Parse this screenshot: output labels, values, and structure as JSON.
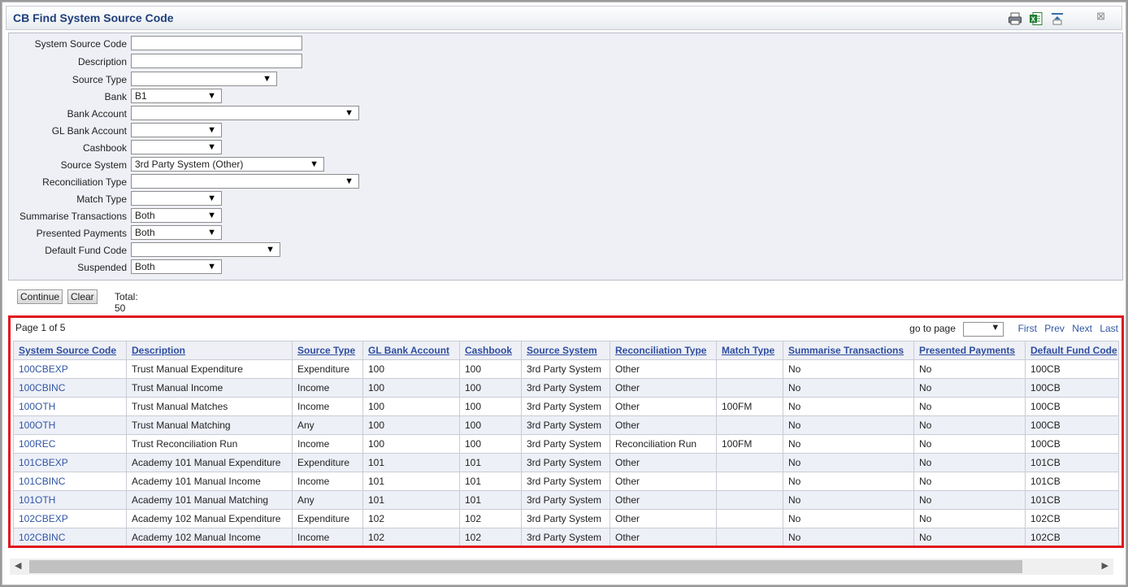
{
  "window": {
    "title": "CB Find System Source Code"
  },
  "toolbar": {
    "icons": [
      "printer-icon",
      "excel-export-icon",
      "collapse-panel-icon"
    ],
    "close": "⊠"
  },
  "filters": [
    {
      "label": "System Source Code",
      "value": "",
      "type": "text"
    },
    {
      "label": "Description",
      "value": "",
      "type": "text"
    },
    {
      "label": "Source Type",
      "value": "",
      "type": "select"
    },
    {
      "label": "Bank",
      "value": "B1",
      "type": "select"
    },
    {
      "label": "Bank Account",
      "value": "",
      "type": "select"
    },
    {
      "label": "GL Bank Account",
      "value": "",
      "type": "select"
    },
    {
      "label": "Cashbook",
      "value": "",
      "type": "select"
    },
    {
      "label": "Source System",
      "value": "3rd Party System (Other)",
      "type": "select"
    },
    {
      "label": "Reconciliation Type",
      "value": "",
      "type": "select"
    },
    {
      "label": "Match Type",
      "value": "",
      "type": "select"
    },
    {
      "label": "Summarise Transactions",
      "value": "Both",
      "type": "select"
    },
    {
      "label": "Presented Payments",
      "value": "Both",
      "type": "select"
    },
    {
      "label": "Default Fund Code",
      "value": "",
      "type": "select"
    },
    {
      "label": "Suspended",
      "value": "Both",
      "type": "select"
    }
  ],
  "actions": {
    "continue_label": "Continue",
    "clear_label": "Clear",
    "total_label": "Total: 50"
  },
  "pager": {
    "page_info": "Page 1 of 5",
    "goto_label": "go to page",
    "goto_value": "",
    "first": "First",
    "prev": "Prev",
    "next": "Next",
    "last": "Last"
  },
  "table": {
    "columns": [
      "System Source Code",
      "Description",
      "Source Type",
      "GL Bank Account",
      "Cashbook",
      "Source System",
      "Reconciliation Type",
      "Match Type",
      "Summarise Transactions",
      "Presented Payments",
      "Default Fund Code"
    ],
    "rows": [
      [
        "100CBEXP",
        "Trust Manual Expenditure",
        "Expenditure",
        "100",
        "100",
        "3rd Party System",
        "Other",
        "",
        "No",
        "No",
        "100CB"
      ],
      [
        "100CBINC",
        "Trust Manual Income",
        "Income",
        "100",
        "100",
        "3rd Party System",
        "Other",
        "",
        "No",
        "No",
        "100CB"
      ],
      [
        "100OTH",
        "Trust Manual Matches",
        "Income",
        "100",
        "100",
        "3rd Party System",
        "Other",
        "100FM",
        "No",
        "No",
        "100CB"
      ],
      [
        "100OTH",
        "Trust Manual Matching",
        "Any",
        "100",
        "100",
        "3rd Party System",
        "Other",
        "",
        "No",
        "No",
        "100CB"
      ],
      [
        "100REC",
        "Trust Reconciliation Run",
        "Income",
        "100",
        "100",
        "3rd Party System",
        "Reconciliation Run",
        "100FM",
        "No",
        "No",
        "100CB"
      ],
      [
        "101CBEXP",
        "Academy 101 Manual Expenditure",
        "Expenditure",
        "101",
        "101",
        "3rd Party System",
        "Other",
        "",
        "No",
        "No",
        "101CB"
      ],
      [
        "101CBINC",
        "Academy 101 Manual Income",
        "Income",
        "101",
        "101",
        "3rd Party System",
        "Other",
        "",
        "No",
        "No",
        "101CB"
      ],
      [
        "101OTH",
        "Academy 101 Manual Matching",
        "Any",
        "101",
        "101",
        "3rd Party System",
        "Other",
        "",
        "No",
        "No",
        "101CB"
      ],
      [
        "102CBEXP",
        "Academy 102 Manual Expenditure",
        "Expenditure",
        "102",
        "102",
        "3rd Party System",
        "Other",
        "",
        "No",
        "No",
        "102CB"
      ],
      [
        "102CBINC",
        "Academy 102 Manual Income",
        "Income",
        "102",
        "102",
        "3rd Party System",
        "Other",
        "",
        "No",
        "No",
        "102CB"
      ]
    ]
  }
}
